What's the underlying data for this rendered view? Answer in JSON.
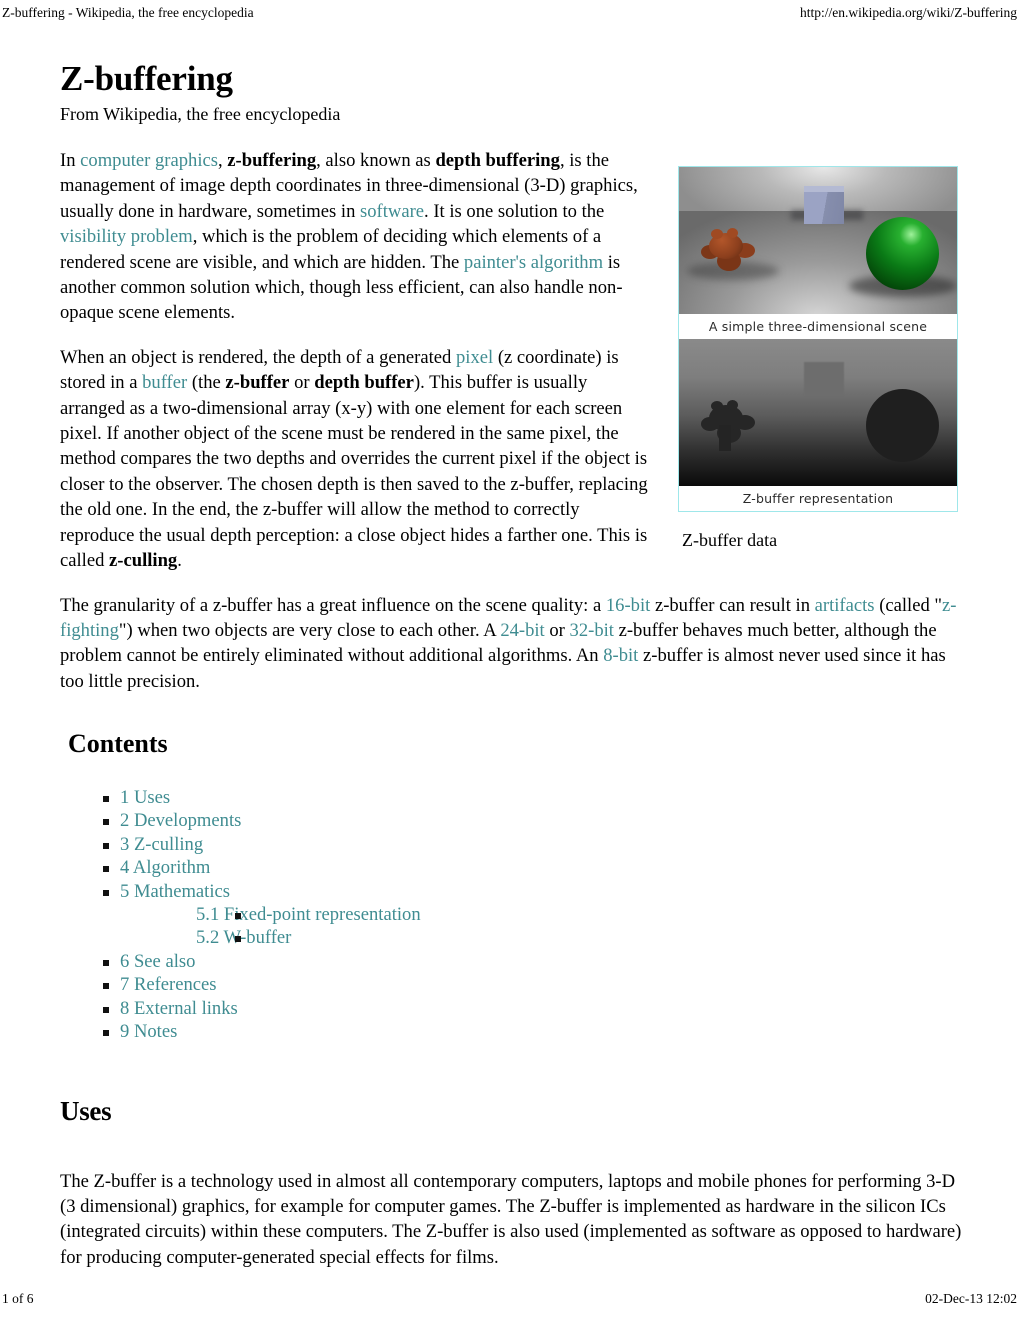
{
  "print_header": {
    "left": "Z-buffering - Wikipedia, the free encyclopedia",
    "right": "http://en.wikipedia.org/wiki/Z-buffering"
  },
  "print_footer": {
    "left": "1 of 6",
    "right": "02-Dec-13 12:02"
  },
  "article": {
    "title": "Z-buffering",
    "tagline": "From Wikipedia, the free encyclopedia",
    "paragraph1": {
      "t1": "In ",
      "link1": "computer graphics",
      "t2": ", ",
      "b1": "z-buffering",
      "t3": ", also known as ",
      "b2": "depth buffering",
      "t4": ", is the management of image depth coordinates in three-dimensional (3-D) graphics, usually done in hardware, sometimes in ",
      "link2": "software",
      "t5": ". It is one solution to the ",
      "link3": "visibility problem",
      "t6": ", which is the problem of deciding which elements of a rendered scene are visible, and which are hidden. The ",
      "link4": "painter's algorithm",
      "t7": " is another common solution which, though less efficient, can also handle non-opaque scene elements."
    },
    "paragraph2": {
      "t1": "When an object is rendered, the depth of a generated ",
      "link1": "pixel",
      "t2": " (z coordinate) is stored in a ",
      "link2": "buffer",
      "t3": " (the ",
      "b1": "z-buffer",
      "t4": " or ",
      "b2": "depth buffer",
      "t5": "). This buffer is usually arranged as a two-dimensional array (x-y) with one element for each screen pixel. If another object of the scene must be rendered in the same pixel, the method compares the two depths and overrides the current pixel if the object is closer to the observer. The chosen depth is then saved to the z-buffer, replacing the old one. In the end, the z-buffer will allow the method to correctly reproduce the usual depth perception: a close object hides a farther one. This is called ",
      "b3": "z-culling",
      "t6": "."
    },
    "paragraph3": {
      "t1": "The granularity of a z-buffer has a great influence on the scene quality: a ",
      "link1": "16-bit",
      "t2": " z-buffer can result in ",
      "link2": "artifacts",
      "t3": " (called \"",
      "link3": "z-fighting",
      "t4": "\") when two objects are very close to each other. A ",
      "link4": "24-bit",
      "t5": " or ",
      "link5": "32-bit",
      "t6": " z-buffer behaves much better, although the problem cannot be entirely eliminated without additional algorithms. An ",
      "link6": "8-bit",
      "t7": " z-buffer is almost never used since it has too little precision."
    }
  },
  "figure": {
    "caption_top": "A simple three-dimensional scene",
    "caption_bottom": "Z-buffer representation",
    "outer_caption": "Z-buffer data"
  },
  "contents": {
    "heading": "Contents",
    "items": [
      {
        "label": "1 Uses"
      },
      {
        "label": "2 Developments"
      },
      {
        "label": "3 Z-culling"
      },
      {
        "label": "4 Algorithm"
      },
      {
        "label": "5 Mathematics",
        "children": [
          {
            "label": "5.1 Fixed-point representation"
          },
          {
            "label": "5.2 W-buffer"
          }
        ]
      },
      {
        "label": "6 See also"
      },
      {
        "label": "7 References"
      },
      {
        "label": "8 External links"
      },
      {
        "label": "9 Notes"
      }
    ]
  },
  "uses": {
    "heading": "Uses",
    "paragraph": "The Z-buffer is a technology used in almost all contemporary computers, laptops and mobile phones for performing 3-D (3 dimensional) graphics, for example for computer games. The Z-buffer is implemented as hardware in the silicon ICs (integrated circuits) within these computers. The Z-buffer is also used (implemented as software as opposed to hardware) for producing computer-generated special effects for films."
  },
  "colors": {
    "link": "#3f8c91",
    "text": "#000000",
    "figure_border": "#9fe7ea",
    "background": "#ffffff"
  }
}
